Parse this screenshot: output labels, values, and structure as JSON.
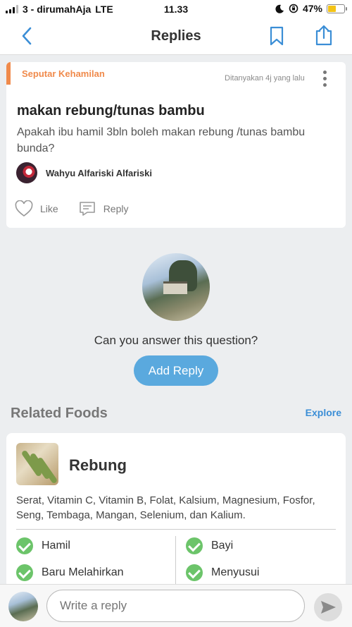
{
  "status_bar": {
    "carrier": "3 - dirumahAja",
    "network": "LTE",
    "time": "11.33",
    "battery": "47%",
    "battery_level": 0.47
  },
  "nav": {
    "title": "Replies"
  },
  "question": {
    "category": "Seputar Kehamilan",
    "asked": "Ditanyakan 4j yang lalu",
    "title": "makan rebung/tunas bambu",
    "body": "Apakah ibu hamil 3bln boleh makan rebung /tunas bambu bunda?",
    "author": "Wahyu Alfariski Alfariski",
    "like_label": "Like",
    "reply_label": "Reply"
  },
  "prompt": {
    "text": "Can you answer this question?",
    "button": "Add Reply"
  },
  "related": {
    "title": "Related Foods",
    "explore": "Explore",
    "food": {
      "name": "Rebung",
      "nutrients": "Serat, Vitamin C, Vitamin B, Folat, Kalsium, Magnesium, Fosfor, Seng, Tembaga, Mangan, Selenium, dan Kalium.",
      "tags": [
        "Hamil",
        "Bayi",
        "Baru Melahirkan",
        "Menyusui"
      ]
    }
  },
  "reply_bar": {
    "placeholder": "Write a reply"
  },
  "colors": {
    "accent_blue": "#3b8ed6",
    "category_orange": "#f08a4b",
    "check_green": "#6cc46a",
    "button_blue": "#5aa9de"
  }
}
